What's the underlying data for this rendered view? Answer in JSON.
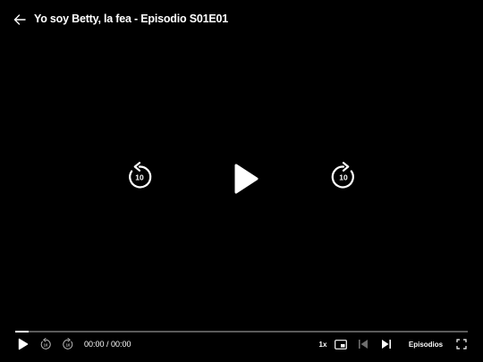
{
  "header": {
    "title": "Yo soy Betty, la fea - Episodio S01E01",
    "back_icon": "arrow-left-icon"
  },
  "center": {
    "rewind_icon": "rewind-10-icon",
    "rewind_label": "10",
    "play_icon": "play-icon",
    "forward_icon": "forward-10-icon",
    "forward_label": "10"
  },
  "progress": {
    "played_fraction": 0.03
  },
  "controls": {
    "play_icon": "play-icon",
    "rewind_icon": "rewind-10-icon",
    "forward_icon": "forward-10-icon",
    "time": "00:00 / 00:00",
    "speed": "1x",
    "pip_icon": "picture-in-picture-icon",
    "prev_icon": "previous-episode-icon",
    "next_icon": "next-episode-icon",
    "episodes_label": "Episodios",
    "fullscreen_icon": "fullscreen-icon"
  },
  "colors": {
    "background": "#000000",
    "foreground": "#ffffff",
    "track": "#5a5a5a",
    "disabled": "#6e6e6e"
  }
}
